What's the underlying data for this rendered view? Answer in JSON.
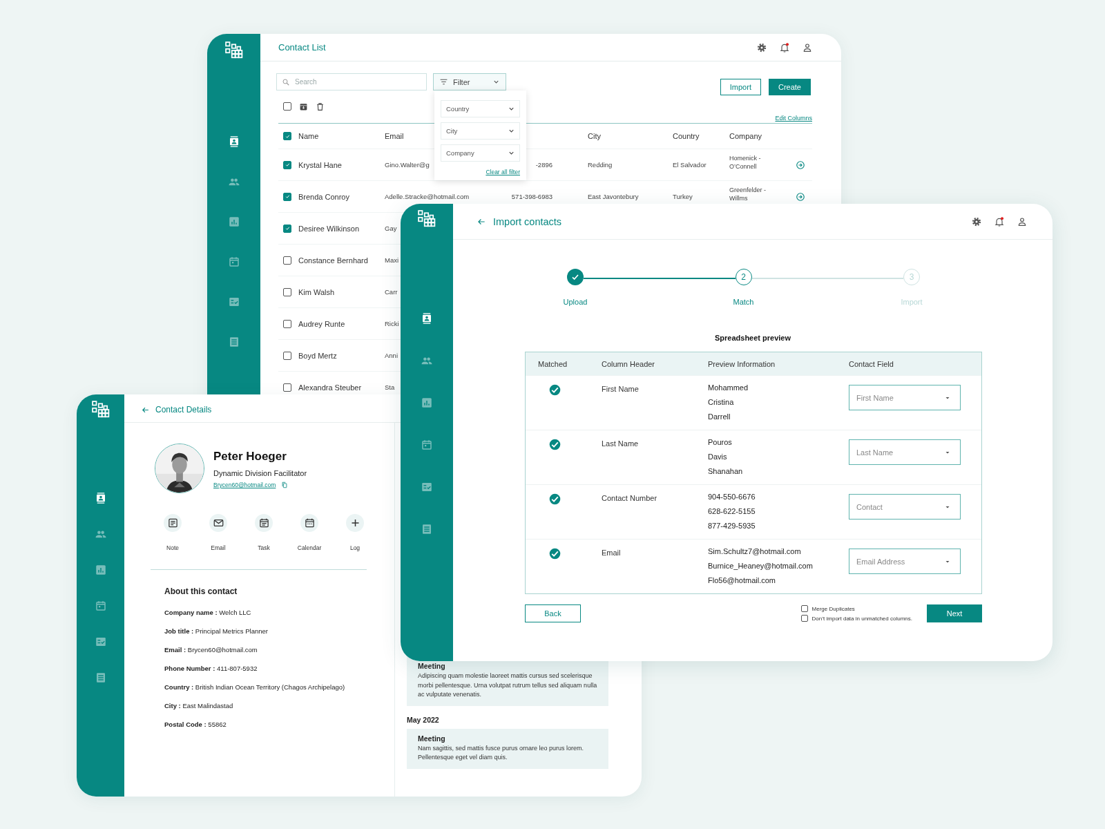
{
  "contact_list": {
    "title": "Contact List",
    "sidebar": {
      "items": [
        {
          "kind": "contacts",
          "selected": true
        },
        {
          "kind": "people",
          "selected": false
        },
        {
          "kind": "chart",
          "selected": false
        },
        {
          "kind": "calendar",
          "selected": false
        },
        {
          "kind": "checklist",
          "selected": false
        },
        {
          "kind": "list",
          "selected": false
        }
      ]
    },
    "notifications": {
      "unread": true
    },
    "search": {
      "placeholder": "Search"
    },
    "filter": {
      "label": "Filter",
      "expanded": true,
      "options": [
        "Country",
        "City",
        "Company"
      ],
      "clear_link": "Clear all filter"
    },
    "actions": [
      {
        "label": "Import",
        "kind": "outline"
      },
      {
        "label": "Create",
        "kind": "primary"
      }
    ],
    "bulk_select": {
      "checked": false
    },
    "edit_columns": "Edit Columns",
    "header": {
      "checked": true,
      "name": "Name",
      "email": "Email",
      "city": "City",
      "country": "Country",
      "company": "Company"
    },
    "rows": [
      {
        "checked": true,
        "name": "Krystal Hane",
        "email": "Gino.Walter@g",
        "phone": "-2896",
        "city": "Redding",
        "country": "El Salvador",
        "company": "Homenick - O’Connell"
      },
      {
        "checked": true,
        "name": "Brenda Conroy",
        "email": "Adelle.Stracke@hotmail.com",
        "phone": "571-398-6983",
        "city": "East Javontebury",
        "country": "Turkey",
        "company": "Greenfelder - Willms"
      },
      {
        "checked": true,
        "name": "Desiree Wilkinson",
        "email": "Gay"
      },
      {
        "checked": false,
        "name": "Constance Bernhard",
        "email": "Maxi"
      },
      {
        "checked": false,
        "name": "Kim Walsh",
        "email": "Carr"
      },
      {
        "checked": false,
        "name": "Audrey Runte",
        "email": "Ricki"
      },
      {
        "checked": false,
        "name": "Boyd Mertz",
        "email": "Anni"
      },
      {
        "checked": false,
        "name": "Alexandra Steuber",
        "email": "Sta"
      }
    ]
  },
  "contact_details": {
    "title": "Contact Details",
    "sidebar": {
      "items": [
        {
          "kind": "contacts",
          "selected": true
        },
        {
          "kind": "people",
          "selected": false
        },
        {
          "kind": "chart",
          "selected": false
        },
        {
          "kind": "calendar",
          "selected": false
        },
        {
          "kind": "checklist",
          "selected": false
        },
        {
          "kind": "list",
          "selected": false
        }
      ]
    },
    "name": "Peter Hoeger",
    "job": "Dynamic Division Facilitator",
    "email": "Brycen60@hotmail.com",
    "actions": [
      {
        "kind": "note",
        "label": "Note"
      },
      {
        "kind": "email",
        "label": "Email"
      },
      {
        "kind": "task",
        "label": "Task"
      },
      {
        "kind": "calendar",
        "label": "Calendar"
      },
      {
        "kind": "log",
        "label": "Log"
      }
    ],
    "about_title": "About this contact",
    "fields": [
      {
        "label": "Company name :",
        "value": "Welch LLC"
      },
      {
        "label": "Job title :",
        "value": "Principal Metrics Planner"
      },
      {
        "label": "Email :",
        "value": "Brycen60@hotmail.com"
      },
      {
        "label": "Phone Number :",
        "value": "411-807-5932"
      },
      {
        "label": "Country :",
        "value": "British Indian Ocean Territory (Chagos Archipelago)"
      },
      {
        "label": "City :",
        "value": "East Malindastad"
      },
      {
        "label": "Postal Code :",
        "value": "55862"
      }
    ],
    "timeline": [
      {
        "kind": "entry",
        "title": "Meeting",
        "text": "Adipiscing quam molestie laoreet mattis cursus sed scelerisque morbi pellentesque. Urna volutpat rutrum tellus sed aliquam nulla ac vulputate venenatis."
      },
      {
        "kind": "month",
        "label": "May 2022"
      },
      {
        "kind": "entry",
        "title": "Meeting",
        "text": "Nam sagittis, sed mattis fusce purus ornare leo purus lorem. Pellentesque eget vel diam quis."
      }
    ]
  },
  "import_contacts": {
    "title": "Import contacts",
    "sidebar": {
      "items": [
        {
          "kind": "contacts",
          "selected": true
        },
        {
          "kind": "people",
          "selected": false
        },
        {
          "kind": "chart",
          "selected": false
        },
        {
          "kind": "calendar",
          "selected": false
        },
        {
          "kind": "checklist",
          "selected": false
        },
        {
          "kind": "list",
          "selected": false
        }
      ]
    },
    "notifications": {
      "unread": true
    },
    "steps": [
      {
        "label": "Upload",
        "completed": true,
        "current": false
      },
      {
        "label": "Match",
        "number": "2",
        "completed": false,
        "current": true
      },
      {
        "label": "Import",
        "number": "3",
        "completed": false,
        "current": false
      }
    ],
    "preview_title": "Spreadsheet preview",
    "columns": [
      "Matched",
      "Column Header",
      "Preview Information",
      "Contact Field"
    ],
    "rows": [
      {
        "matched": true,
        "header": "First Name",
        "preview": [
          "Mohammed",
          "Cristina",
          "Darrell"
        ],
        "field": "First Name"
      },
      {
        "matched": true,
        "header": "Last Name",
        "preview": [
          "Pouros",
          "Davis",
          "Shanahan"
        ],
        "field": "Last Name"
      },
      {
        "matched": true,
        "header": "Contact Number",
        "preview": [
          "904-550-6676",
          "628-622-5155",
          "877-429-5935"
        ],
        "field": "Contact"
      },
      {
        "matched": true,
        "header": "Email",
        "preview": [
          "Sim.Schultz7@hotmail.com",
          "Burnice_Heaney@hotmail.com",
          "Flo56@hotmail.com"
        ],
        "field": "Email Address"
      }
    ],
    "back": "Back",
    "options": [
      {
        "label": "Merge Duplicates",
        "checked": false
      },
      {
        "label": "Don’t import data in unmatched columns.",
        "checked": false
      }
    ],
    "next": "Next"
  }
}
